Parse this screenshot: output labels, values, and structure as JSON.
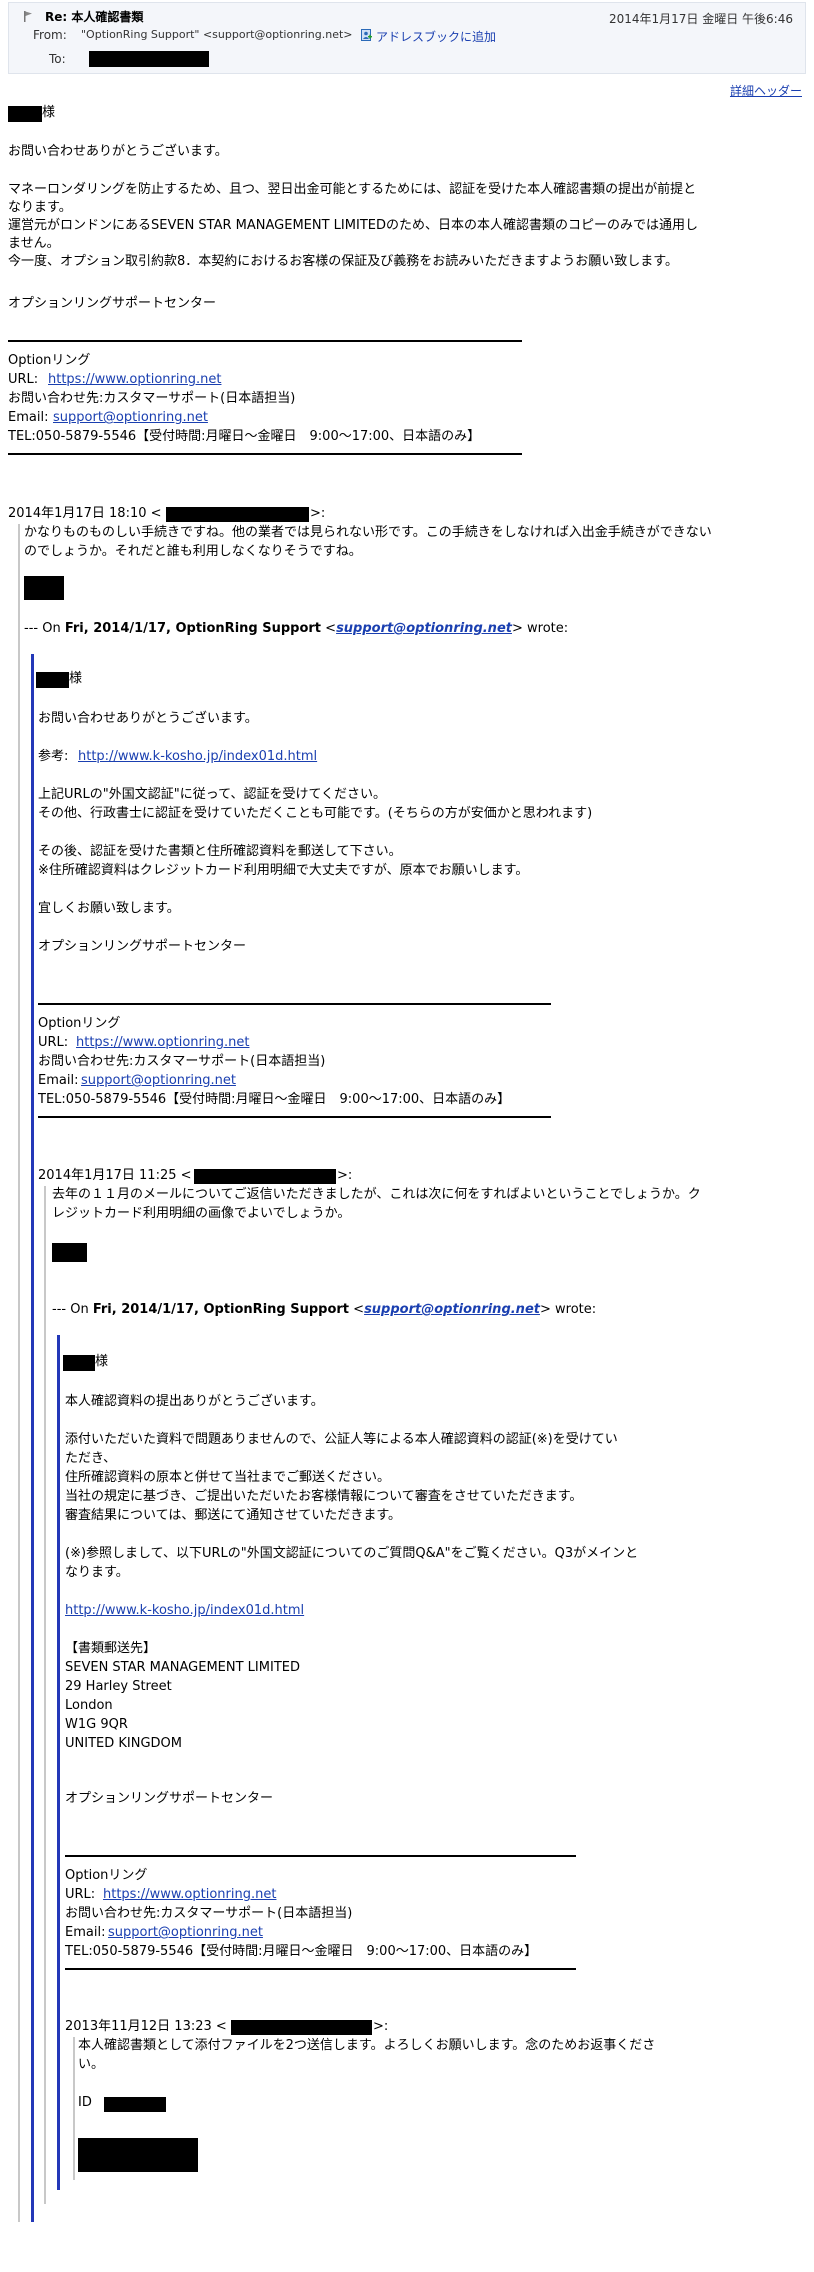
{
  "header": {
    "subject": "Re: 本人確認書類",
    "date": "2014年1月17日 金曜日 午後6:46",
    "from_label": "From:",
    "from_value": "\"OptionRing Support\" <support@optionring.net>",
    "add_to_addressbook": "アドレスブックに追加",
    "to_label": "To:",
    "detail_header_link": "詳細ヘッダー"
  },
  "reply": {
    "salutation": "様",
    "greeting": "お問い合わせありがとうございます。",
    "body": [
      "マネーロンダリングを防止するため、且つ、翌日出金可能とするためには、認証を受けた本人確認書類の提出が前提と",
      "なります。",
      "運営元がロンドンにあるSEVEN STAR MANAGEMENT LIMITEDのため、日本の本人確認書類のコピーのみでは通用し",
      "ません。",
      "今一度、オプション取引約款8．本契約におけるお客様の保証及び義務をお読みいただきますようお願い致します。"
    ],
    "sign": "オプションリングサポートセンター"
  },
  "signature": {
    "name": "Optionリング",
    "url_label": "URL:",
    "url": "https://www.optionring.net",
    "contact": "お問い合わせ先:カスタマーサポート(日本語担当)",
    "email_label": "Email:",
    "email": "support@optionring.net",
    "tel": "TEL:050-5879-5546【受付時間:月曜日～金曜日　9:00～17:00、日本語のみ】"
  },
  "quote1": {
    "date": "2014年1月17日 18:10 <",
    "lines": [
      "かなりものものしい手続きですね。他の業者では見られない形です。この手続きをしなければ入出金手続きができない",
      "のでしょうか。それだと誰も利用しなくなりそうですね。"
    ],
    "wrote_prefix": "--- On ",
    "wrote_date": "Fri, 2014/1/17, OptionRing Support",
    "wrote_email": "support@optionring.net",
    "wrote_suffix": "wrote:"
  },
  "q2": {
    "salutation": "様",
    "greeting": "お問い合わせありがとうございます。",
    "ref_label": "参考:",
    "ref_url": "http://www.k-kosho.jp/index01d.html",
    "lines": [
      "上記URLの\"外国文認証\"に従って、認証を受けてください。",
      "その他、行政書士に認証を受けていただくことも可能です。(そちらの方が安価かと思われます)",
      "",
      "その後、認証を受けた書類と住所確認資料を郵送して下さい。",
      "※住所確認資料はクレジットカード利用明細で大丈夫ですが、原本でお願いします。",
      "",
      "宜しくお願い致します。"
    ],
    "sign": "オプションリングサポートセンター"
  },
  "quote2": {
    "date": "2014年1月17日 11:25 <",
    "lines": [
      "去年の１１月のメールについてご返信いただきましたが、これは次に何をすればよいということでしょうか。ク",
      "レジットカード利用明細の画像でよいでしょうか。"
    ],
    "wrote_prefix": "--- On ",
    "wrote_date": "Fri, 2014/1/17, OptionRing Support",
    "wrote_email": "support@optionring.net",
    "wrote_suffix": "wrote:"
  },
  "q3": {
    "salutation": "様",
    "greeting": "本人確認資料の提出ありがとうございます。",
    "lines": [
      "添付いただいた資料で問題ありませんので、公証人等による本人確認資料の認証(※)を受けてい",
      "ただき、",
      "住所確認資料の原本と併せて当社までご郵送ください。",
      "当社の規定に基づき、ご提出いただいたお客様情報について審査をさせていただきます。",
      "審査結果については、郵送にて通知させていただきます。",
      "",
      "(※)参照しまして、以下URLの\"外国文認証についてのご質問Q&A\"をご覧ください。Q3がメインと",
      "なります。"
    ],
    "url": "http://www.k-kosho.jp/index01d.html",
    "address": [
      "【書類郵送先】",
      "SEVEN STAR MANAGEMENT LIMITED",
      "29 Harley Street",
      "London",
      "W1G 9QR",
      "UNITED KINGDOM"
    ],
    "sign": "オプションリングサポートセンター"
  },
  "quote3": {
    "date": "2013年11月12日 13:23 <",
    "lines": [
      "本人確認書類として添付ファイルを2つ送信します。よろしくお願いします。念のためお返事くださ",
      "い。"
    ],
    "id_label": "ID"
  },
  "colors": {
    "link": "#1a3fb0",
    "quote_bar": "#2338b8",
    "header_bg": "#f4f6fa"
  }
}
